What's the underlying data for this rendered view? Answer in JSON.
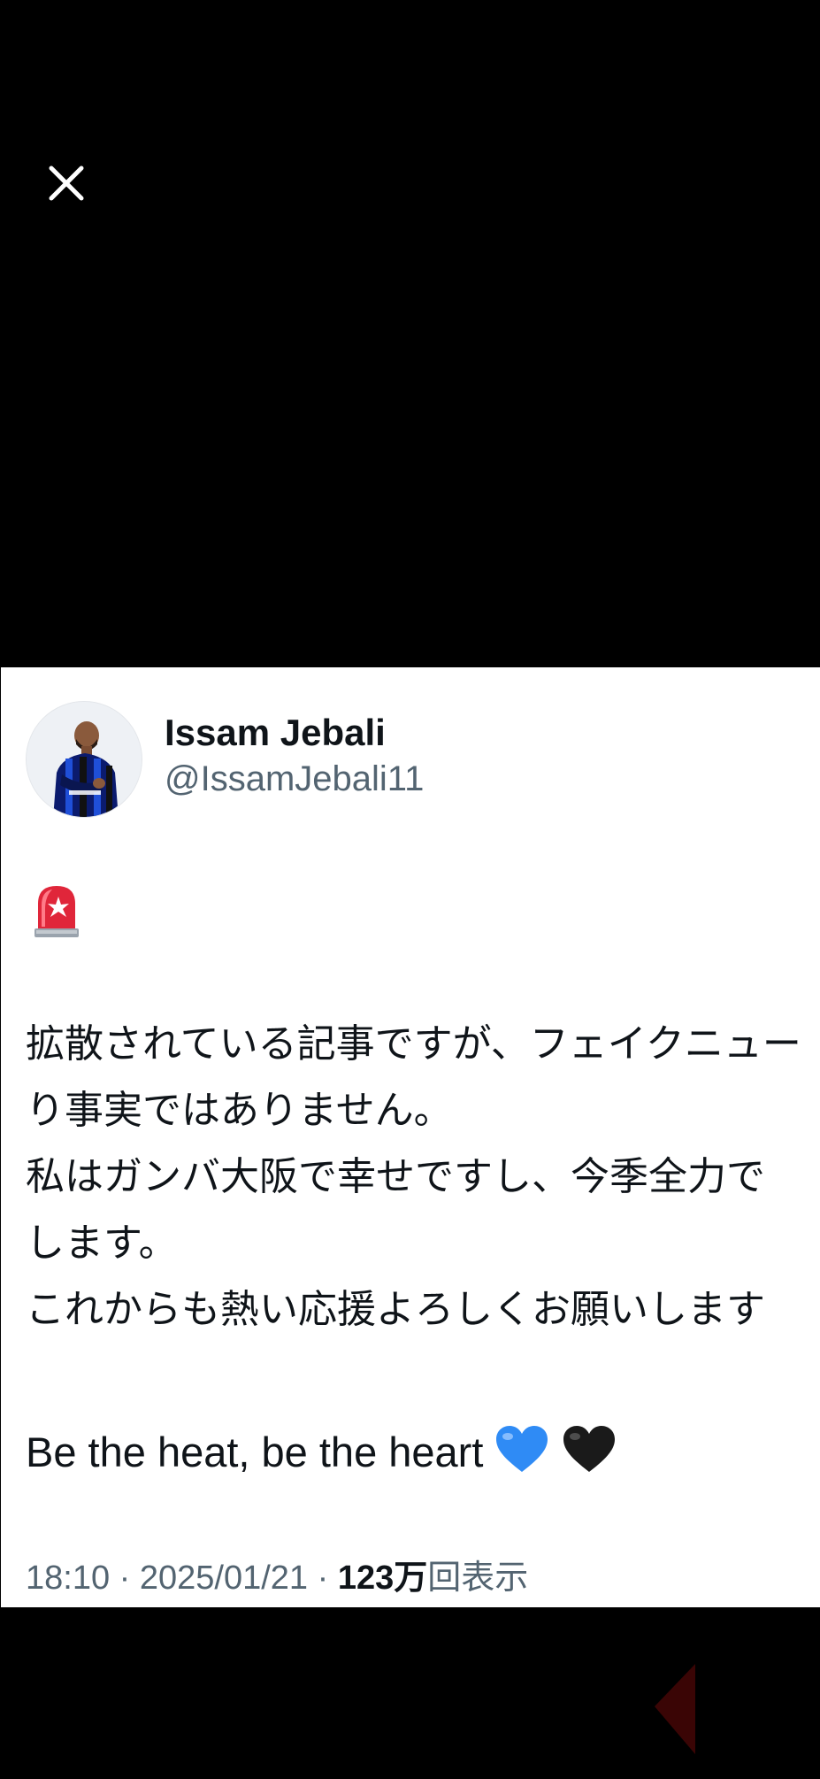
{
  "viewer": {
    "close_icon": "close-icon"
  },
  "tweet": {
    "display_name": "Issam Jebali",
    "handle": "@IssamJebali11",
    "alert_icon": "siren-emoji",
    "body_lines": [
      "拡散されている記事ですが、フェイクニュー",
      "り事実ではありません。",
      "私はガンバ大阪で幸せですし、今季全力で",
      "します。",
      "これからも熱い応援よろしくお願いします"
    ],
    "tagline": "Be the heat, be the heart",
    "heart_icons": [
      "blue-heart-emoji",
      "black-heart-emoji"
    ],
    "time": "18:10",
    "separator": " · ",
    "date": "2025/01/21",
    "views_count": "123万",
    "views_label": "回表示"
  }
}
